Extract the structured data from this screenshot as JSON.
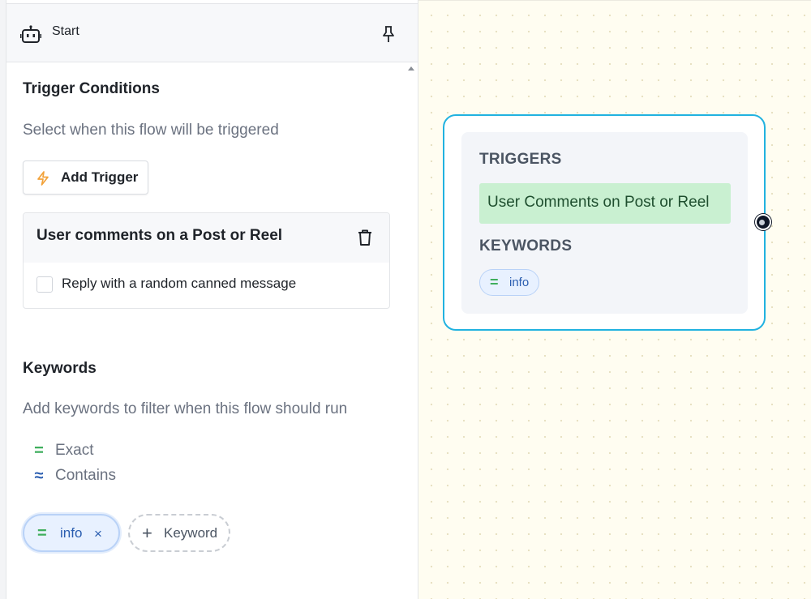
{
  "header": {
    "title": "Start",
    "icon": "robot-icon",
    "pin_icon": "pin-icon"
  },
  "trigger_section": {
    "title": "Trigger Conditions",
    "subtitle": "Select when this flow will be triggered",
    "add_button_label": "Add Trigger",
    "add_button_icon": "bolt-icon",
    "card": {
      "title": "User comments on a Post or Reel",
      "delete_icon": "trash-icon",
      "checkbox_label": "Reply with a random canned message",
      "checkbox_checked": false
    }
  },
  "keywords_section": {
    "title": "Keywords",
    "subtitle": "Add keywords to filter when this flow should run",
    "match_types": [
      {
        "symbol": "=",
        "label": "Exact",
        "color": "#3fae5d"
      },
      {
        "symbol": "≈",
        "label": "Contains",
        "color": "#2a5db0"
      }
    ],
    "keywords": [
      {
        "symbol": "=",
        "text": "info",
        "remove": "×"
      }
    ],
    "add_keyword_label": "Keyword",
    "add_keyword_symbol": "+"
  },
  "node": {
    "triggers_label": "TRIGGERS",
    "trigger_text": "User Comments on Post or Reel",
    "keywords_label": "KEYWORDS",
    "keyword_symbol": "=",
    "keyword_text": "info"
  },
  "colors": {
    "node_border": "#21b2e0",
    "trigger_pill": "#c9f0d1",
    "keyword_chip": "#e8f1ff",
    "exact_green": "#3fae5d",
    "contains_blue": "#2a5db0",
    "bolt_orange": "#f2a23a",
    "canvas_bg": "#fffdf1"
  }
}
